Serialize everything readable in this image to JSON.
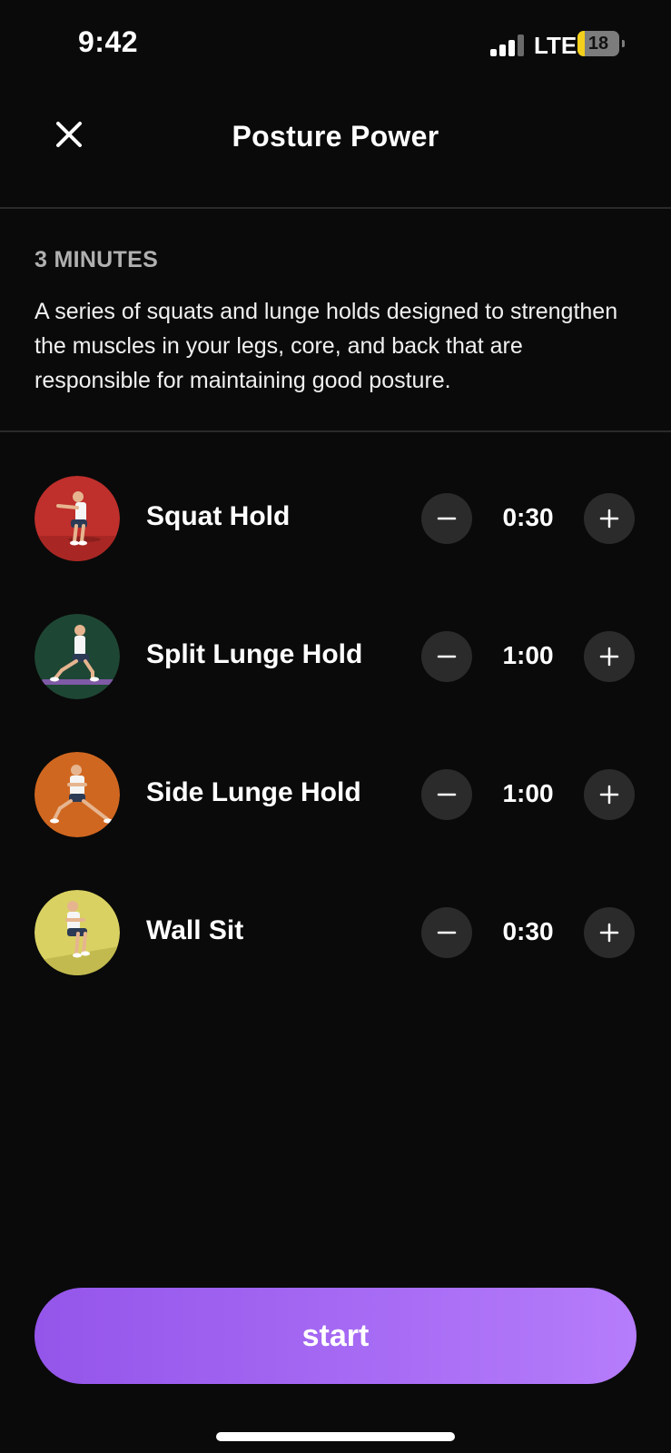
{
  "status_bar": {
    "time": "9:42",
    "network": "LTE",
    "battery": "18",
    "battery_level": 0.18,
    "signal_bars_active": 3,
    "signal_bars_total": 4
  },
  "header": {
    "close_icon": "close-icon",
    "title": "Posture Power"
  },
  "routine": {
    "duration": "3 MINUTES",
    "description": "A series of squats and lunge holds designed to strengthen the muscles in your legs, core, and back that are responsible for maintaining good posture."
  },
  "exercises": [
    {
      "name": "Squat Hold",
      "duration": "0:30",
      "thumb_color": "#bf2f2c",
      "icon": "squat-figure"
    },
    {
      "name": "Split Lunge Hold",
      "duration": "1:00",
      "thumb_color": "#1e4634",
      "icon": "split-lunge-figure"
    },
    {
      "name": "Side Lunge Hold",
      "duration": "1:00",
      "thumb_color": "#d06720",
      "icon": "side-lunge-figure"
    },
    {
      "name": "Wall Sit",
      "duration": "0:30",
      "thumb_color": "#d9d162",
      "icon": "wall-sit-figure"
    }
  ],
  "controls": {
    "minus_icon": "minus-icon",
    "plus_icon": "plus-icon"
  },
  "start_button": {
    "label": "start",
    "gradient_from": "#9455ea",
    "gradient_to": "#b57cfb"
  },
  "theme": {
    "background": "#0a0a0a",
    "divider": "#2a2a2a",
    "stepper_bg": "#2b2b2b"
  }
}
